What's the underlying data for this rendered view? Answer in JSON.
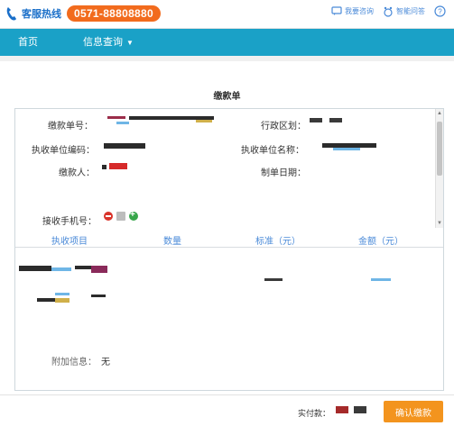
{
  "header": {
    "hotline_label": "客服热线",
    "hotline_number": "0571-88808880",
    "links": [
      {
        "label": "我要咨询",
        "icon": "chat-icon"
      },
      {
        "label": "智能问答",
        "icon": "robot-icon"
      }
    ],
    "help_icon": "help-icon"
  },
  "nav": {
    "home": "首页",
    "info_query": "信息查询"
  },
  "page": {
    "title": "缴款单"
  },
  "form": {
    "payment_no_label": "缴款单号：",
    "region_label": "行政区划：",
    "unit_code_label": "执收单位编码：",
    "unit_name_label": "执收单位名称：",
    "payer_label": "缴款人：",
    "issue_date_label": "制单日期：",
    "phone_label": "接收手机号：",
    "redacted_values": true
  },
  "table": {
    "columns": [
      "执收项目",
      "数量",
      "标准（元）",
      "金额（元）"
    ]
  },
  "extra": {
    "label": "附加信息：",
    "value": "无"
  },
  "footer": {
    "paid_label": "实付款：",
    "confirm_label": "确认缴款"
  },
  "colors": {
    "nav_bg": "#1aa1c7",
    "hotline_bg": "#f26b1d",
    "confirm_bg": "#f3941e",
    "link_blue": "#4a8ad8"
  }
}
